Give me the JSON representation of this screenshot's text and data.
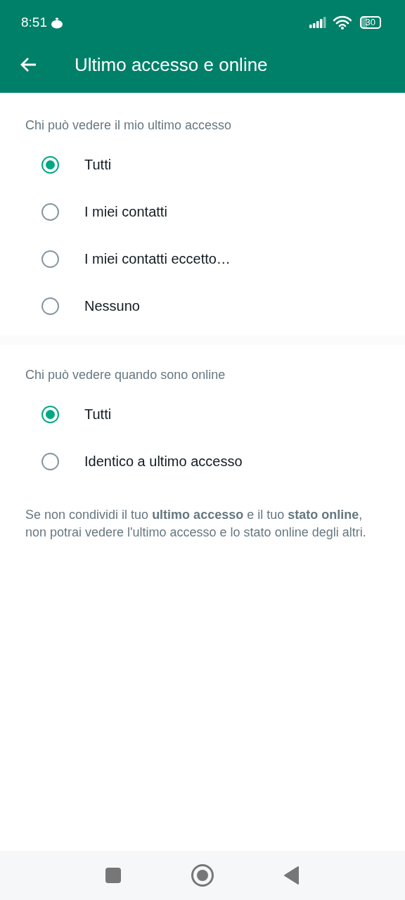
{
  "status_bar": {
    "time": "8:51",
    "battery": "30"
  },
  "app_bar": {
    "title": "Ultimo accesso e online"
  },
  "sections": [
    {
      "title": "Chi può vedere il mio ultimo accesso",
      "options": [
        {
          "label": "Tutti",
          "selected": true
        },
        {
          "label": "I miei contatti",
          "selected": false
        },
        {
          "label": "I miei contatti eccetto…",
          "selected": false
        },
        {
          "label": "Nessuno",
          "selected": false
        }
      ]
    },
    {
      "title": "Chi può vedere quando sono online",
      "options": [
        {
          "label": "Tutti",
          "selected": true
        },
        {
          "label": "Identico a ultimo accesso",
          "selected": false
        }
      ]
    }
  ],
  "note": "Se non condividi il tuo **ultimo accesso** e il tuo **stato online**, non potrai vedere l'ultimo accesso e lo stato online degli altri."
}
